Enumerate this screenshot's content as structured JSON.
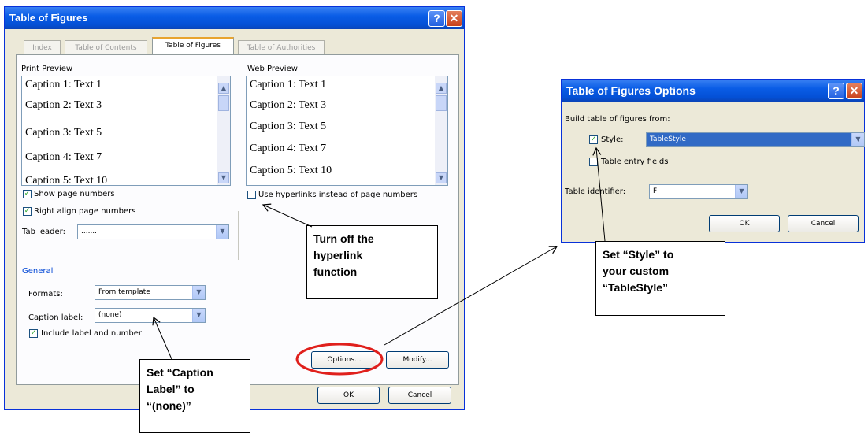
{
  "tof": {
    "title": "Table of Figures",
    "tabs": [
      "Index",
      "Table of Contents",
      "Table of Figures",
      "Table of Authorities"
    ],
    "print_preview_label": "Print Preview",
    "print_preview_lines": [
      "Caption 1: Text 1",
      "Caption 2: Text 3",
      "Caption 3: Text 5",
      "Caption 4: Text 7",
      "Caption 5: Text 10"
    ],
    "web_preview_label": "Web Preview",
    "web_preview_lines": [
      "Caption 1: Text 1",
      "Caption 2: Text 3",
      "Caption 3: Text 5",
      "Caption 4: Text 7",
      "Caption 5: Text 10"
    ],
    "show_page_numbers": "Show page numbers",
    "right_align": "Right align page numbers",
    "tab_leader_label": "Tab leader:",
    "tab_leader_value": ".......",
    "use_hyperlinks": "Use hyperlinks instead of page numbers",
    "general_label": "General",
    "formats_label": "Formats:",
    "formats_value": "From template",
    "caption_label_label": "Caption label:",
    "caption_label_value": "(none)",
    "include_label": "Include label and number",
    "options_button": "Options...",
    "modify_button": "Modify...",
    "ok_button": "OK",
    "cancel_button": "Cancel"
  },
  "tofo": {
    "title": "Table of Figures Options",
    "build_from": "Build table of figures from:",
    "style_label": "Style:",
    "style_value": "TableStyle",
    "entry_fields": "Table entry fields",
    "identifier_label": "Table identifier:",
    "identifier_value": "F",
    "ok_button": "OK",
    "cancel_button": "Cancel"
  },
  "callouts": {
    "hyperlink": [
      "Turn off the",
      "hyperlink",
      "function"
    ],
    "caption": [
      "Set “Caption",
      "Label” to",
      "“(none)”"
    ],
    "style": [
      "Set “Style” to",
      "your custom",
      "“TableStyle”"
    ]
  },
  "icons": {
    "help": "help-icon",
    "close": "close-icon",
    "check": "checkmark-icon",
    "dropdown": "dropdown-arrow-icon"
  },
  "colors": {
    "titlebar": "#0a5de6",
    "dialog_bg": "#ece9d8",
    "highlight_ring": "#e0201c",
    "selection": "#316ac5"
  }
}
